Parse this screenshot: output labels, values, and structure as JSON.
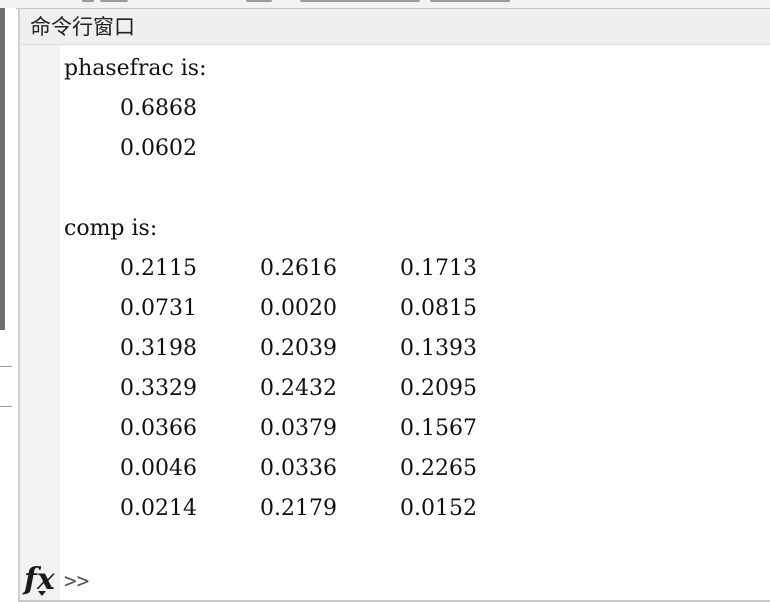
{
  "window": {
    "title": "命令行窗口"
  },
  "output": {
    "phasefrac": {
      "header": "phasefrac is:",
      "values": [
        "0.6868",
        "0.0602"
      ]
    },
    "comp": {
      "header": "comp is:",
      "rows": [
        [
          "0.2115",
          "0.2616",
          "0.1713"
        ],
        [
          "0.0731",
          "0.0020",
          "0.0815"
        ],
        [
          "0.3198",
          "0.2039",
          "0.1393"
        ],
        [
          "0.3329",
          "0.2432",
          "0.2095"
        ],
        [
          "0.0366",
          "0.0379",
          "0.1567"
        ],
        [
          "0.0046",
          "0.0336",
          "0.2265"
        ],
        [
          "0.0214",
          "0.2179",
          "0.0152"
        ]
      ]
    }
  },
  "prompt": {
    "icon": "fx-icon",
    "symbol": ">>",
    "input_value": ""
  }
}
